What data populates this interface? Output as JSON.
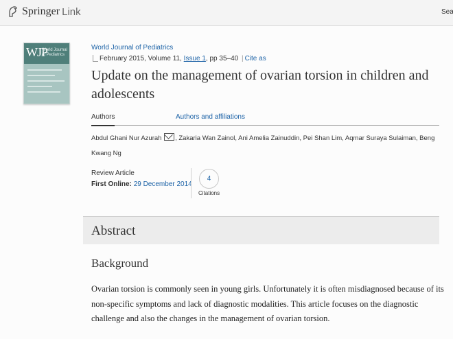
{
  "header": {
    "logo_word": "Springer",
    "logo_link": "Link",
    "search_label": "Sea"
  },
  "cover": {
    "abbr": "WJP",
    "name": "World Journal of Pediatrics"
  },
  "article": {
    "journal": "World Journal of Pediatrics",
    "date_volume": "February 2015, Volume 11, ",
    "issue": "Issue 1",
    "pages": ", pp 35–40 ",
    "cite": "Cite as",
    "title": "Update on the management of ovarian torsion in children and adolescents"
  },
  "tabs": {
    "authors": "Authors",
    "affiliations": "Authors and affiliations"
  },
  "authors": {
    "first": "Abdul Ghani Nur Azurah",
    "rest": ", Zakaria Wan Zainol, Ani Amelia Zainuddin, Pei Shan Lim, Aqmar Suraya Sulaiman, Beng Kwang Ng"
  },
  "info": {
    "type": "Review Article",
    "first_online_label": "First Online:",
    "first_online_date": "29 December 2014",
    "citations_count": "4",
    "citations_label": "Citations"
  },
  "abstract": {
    "heading": "Abstract",
    "subheading": "Background",
    "text": "Ovarian torsion is commonly seen in young girls. Unfortunately it is often misdiagnosed because of its non-specific symptoms and lack of diagnostic modalities. This article focuses on the diagnostic challenge and also the changes in the management of ovarian torsion."
  },
  "colors": {
    "link": "#1d63a7",
    "header_bg": "#f4f4f4",
    "abstract_bg": "#ececec"
  }
}
